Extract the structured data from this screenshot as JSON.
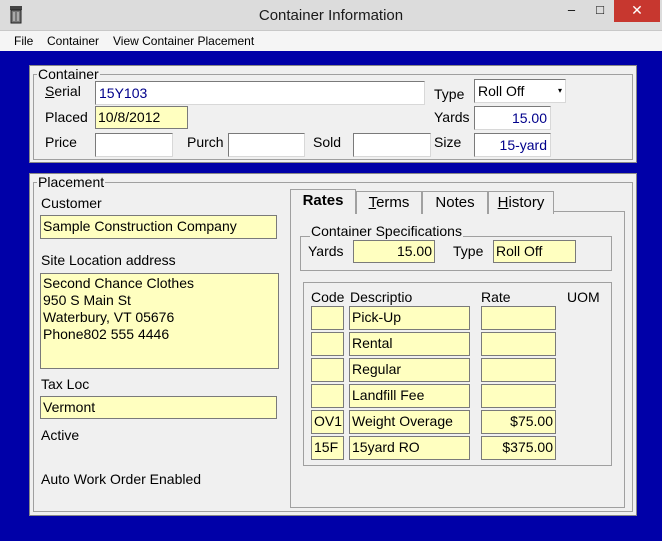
{
  "window": {
    "title": "Container Information",
    "min_glyph": "–",
    "max_glyph": "□",
    "close_glyph": "✕"
  },
  "menu": [
    "File",
    "Container",
    "View Container Placement"
  ],
  "container": {
    "legend": "Container",
    "serial_label": "Serial",
    "serial": "15Y103",
    "placed_label": "Placed",
    "placed": "10/8/2012",
    "price_label": "Price",
    "price": "",
    "purch_label": "Purch",
    "purch": "",
    "sold_label": "Sold",
    "sold": "",
    "type_label": "Type",
    "type": "Roll Off",
    "yards_label": "Yards",
    "yards": "15.00",
    "size_label": "Size",
    "size": "15-yard"
  },
  "placement": {
    "legend": "Placement",
    "customer_label": "Customer",
    "customer": "Sample Construction Company",
    "site_label": "Site Location address",
    "site_address": "Second Chance Clothes\n950 S Main St\nWaterbury, VT 05676\nPhone802 555 4446",
    "tax_label": "Tax  Loc",
    "tax_loc": "Vermont",
    "active_label": "Active",
    "auto_wo_label": "Auto Work Order Enabled"
  },
  "tabs": [
    "Rates",
    "Terms",
    "Notes",
    "History"
  ],
  "specs": {
    "legend": "Container Specifications",
    "yards_label": "Yards",
    "yards": "15.00",
    "type_label": "Type",
    "type": "Roll Off"
  },
  "rates_table": {
    "headers": [
      "Code",
      "Descriptio",
      "Rate",
      "UOM"
    ],
    "rows": [
      {
        "code": "",
        "desc": "Pick-Up",
        "rate": ""
      },
      {
        "code": "",
        "desc": "Rental",
        "rate": ""
      },
      {
        "code": "",
        "desc": "Regular",
        "rate": ""
      },
      {
        "code": "",
        "desc": "Landfill Fee",
        "rate": ""
      },
      {
        "code": "OV1",
        "desc": "Weight Overage",
        "rate": "$75.00"
      },
      {
        "code": "15F",
        "desc": "15yard RO",
        "rate": "$375.00"
      }
    ]
  },
  "colors": {
    "client_bg": "#0000a8",
    "field_yellow": "#ffffc0",
    "value_blue": "#00008b",
    "close_red": "#c7372f"
  }
}
